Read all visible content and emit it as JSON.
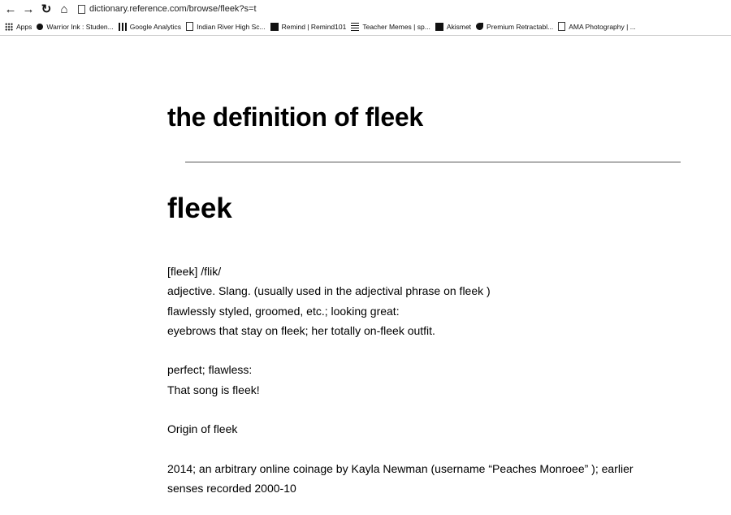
{
  "browser": {
    "url": "dictionary.reference.com/browse/fleek?s=t",
    "nav": {
      "back_icon": "back-arrow",
      "forward_icon": "forward-arrow",
      "reload_icon": "reload",
      "home_icon": "home"
    },
    "bookmarks": [
      {
        "label": "Apps",
        "icon": "apps-grid"
      },
      {
        "label": "Warrior Ink : Studen...",
        "icon": "site-dot"
      },
      {
        "label": "Google Analytics",
        "icon": "analytics-bars"
      },
      {
        "label": "Indian River High Sc...",
        "icon": "page"
      },
      {
        "label": "Remind | Remind101",
        "icon": "remind-square"
      },
      {
        "label": "Teacher Memes | sp...",
        "icon": "memes-lines"
      },
      {
        "label": "Akismet",
        "icon": "akismet-box"
      },
      {
        "label": "Premium Retractabl...",
        "icon": "leaf"
      },
      {
        "label": "AMA Photography | ...",
        "icon": "page"
      }
    ]
  },
  "page": {
    "title": "the definition of fleek",
    "headword": "fleek",
    "pronunciation": "[fleek] /flik/",
    "part_of_speech": "adjective. Slang. (usually used in the adjectival phrase on fleek )",
    "definition_1": "flawlessly styled, groomed, etc.; looking great:",
    "example_1": "eyebrows that stay on fleek; her totally on-fleek outfit.",
    "definition_2": "perfect; flawless:",
    "example_2": "That song is fleek!",
    "origin_heading": "Origin of fleek",
    "origin_line_1": "2014; an arbitrary online coinage by Kayla Newman (username “Peaches Monroee” ); earlier",
    "origin_line_2": "senses recorded 2000-10"
  }
}
